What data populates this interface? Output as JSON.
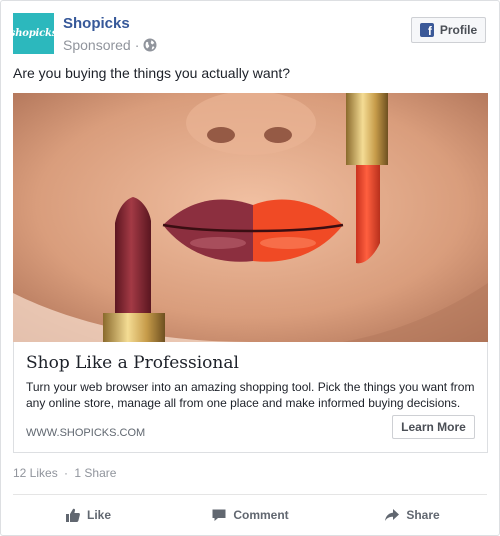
{
  "header": {
    "avatar_text": "shopicks",
    "page_name": "Shopicks",
    "sponsored_label": "Sponsored",
    "separator": "·",
    "profile_button_label": "Profile"
  },
  "post": {
    "text": "Are you buying the things you actually want?"
  },
  "link_card": {
    "title": "Shop Like a Professional",
    "description": "Turn your web browser into an amazing shopping tool. Pick the things you want from any online store, manage all from one place and make informed buying decisions.",
    "url": "WWW.SHOPICKS.COM",
    "cta_label": "Learn More"
  },
  "stats": {
    "likes": "12 Likes",
    "separator": "·",
    "shares": "1 Share"
  },
  "actions": {
    "like_label": "Like",
    "comment_label": "Comment",
    "share_label": "Share"
  },
  "colors": {
    "brand_teal": "#2cb8bd",
    "link_blue": "#365899",
    "facebook_blue": "#3b5998",
    "muted_text": "#90949c"
  },
  "icons": [
    "facebook-logo-icon",
    "globe-icon",
    "like-thumb-icon",
    "comment-bubble-icon",
    "share-arrow-icon"
  ]
}
